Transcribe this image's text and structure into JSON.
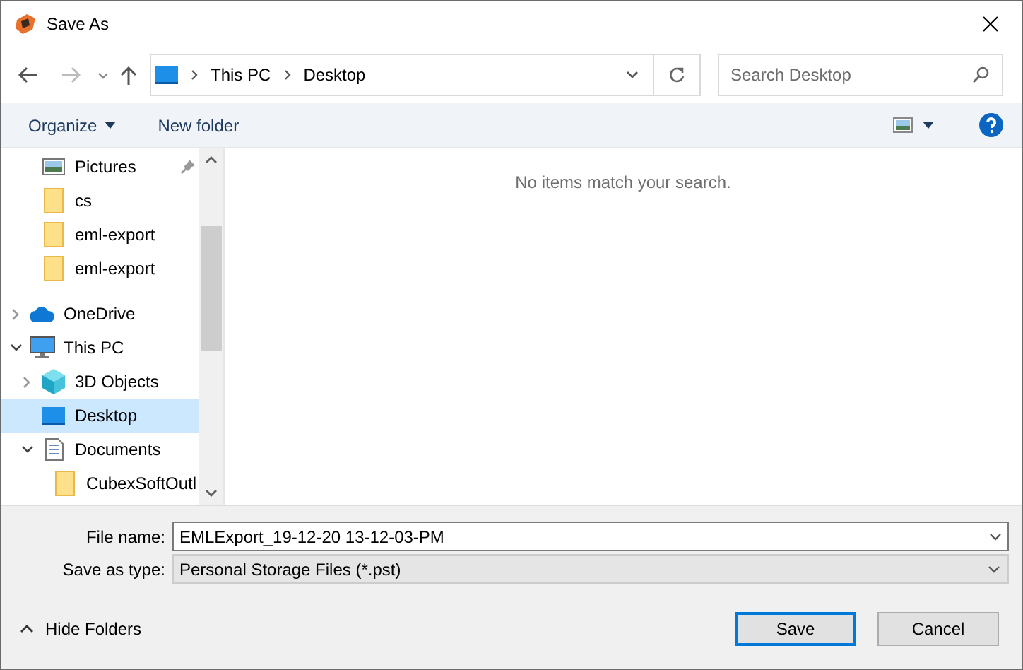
{
  "window": {
    "title": "Save As"
  },
  "address_bar": {
    "path": [
      "This PC",
      "Desktop"
    ]
  },
  "search": {
    "placeholder": "Search Desktop"
  },
  "toolbar": {
    "organize": "Organize",
    "new_folder": "New folder"
  },
  "quick_access_items": [
    {
      "label": "Pictures",
      "kind": "pictures",
      "pinned": true
    },
    {
      "label": "cs",
      "kind": "folder",
      "pinned": false
    },
    {
      "label": "eml-export",
      "kind": "folder",
      "pinned": false
    },
    {
      "label": "eml-export",
      "kind": "folder",
      "pinned": false
    }
  ],
  "tree": [
    {
      "label": "OneDrive",
      "kind": "cloud",
      "expanded": false,
      "selected": false
    },
    {
      "label": "This PC",
      "kind": "pc",
      "expanded": true,
      "selected": false,
      "children": [
        {
          "label": "3D Objects",
          "kind": "cube",
          "expanded": false,
          "selected": false
        },
        {
          "label": "Desktop",
          "kind": "desktop",
          "selected": true
        },
        {
          "label": "Documents",
          "kind": "documents",
          "expanded": true,
          "selected": false,
          "children": [
            {
              "label": "CubexSoftOutl",
              "kind": "folder",
              "selected": false
            }
          ]
        }
      ]
    }
  ],
  "content": {
    "empty_message": "No items match your search."
  },
  "file_name": {
    "label": "File name:",
    "value": "EMLExport_19-12-20 13-12-03-PM"
  },
  "save_as_type": {
    "label": "Save as type:",
    "value": "Personal Storage Files (*.pst)"
  },
  "hide_folders": "Hide Folders",
  "buttons": [
    {
      "label": "Save",
      "kind": "primary"
    },
    {
      "label": "Cancel",
      "kind": "normal"
    }
  ]
}
